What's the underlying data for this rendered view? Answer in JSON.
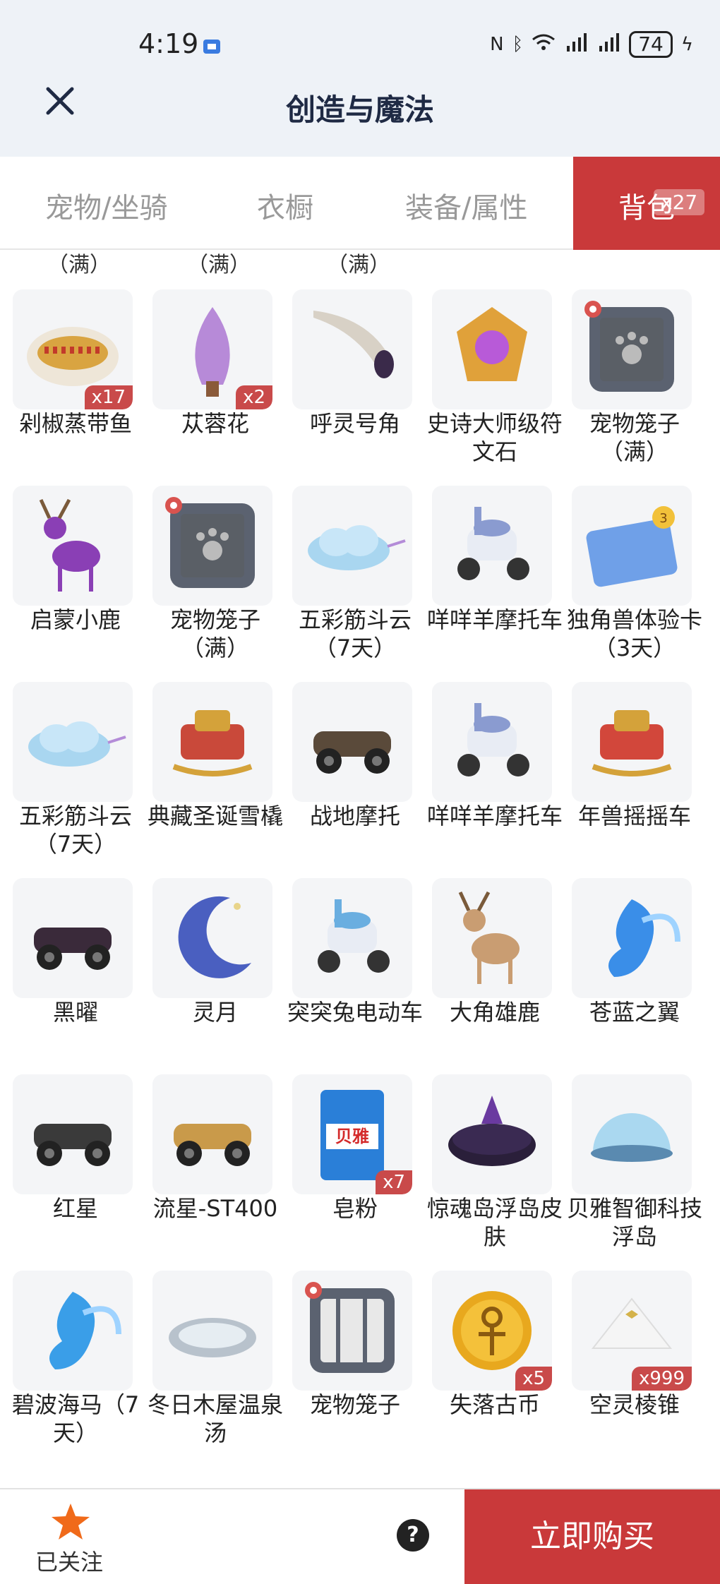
{
  "status": {
    "time": "4:19",
    "battery": "74"
  },
  "header": {
    "title": "创造与魔法"
  },
  "tabs": [
    {
      "label": "宠物/坐骑"
    },
    {
      "label": "衣橱"
    },
    {
      "label": "装备/属性"
    },
    {
      "label": "背包",
      "badge": "x27"
    }
  ],
  "partial_row": [
    "（满）",
    "（满）",
    "（满）"
  ],
  "items": [
    {
      "name": "剁椒蒸带鱼",
      "qty": "x17",
      "icon": "fish-dish-icon",
      "color": "#d9a441"
    },
    {
      "name": "苁蓉花",
      "qty": "x2",
      "icon": "flower-icon",
      "color": "#b78ad8"
    },
    {
      "name": "呼灵号角",
      "qty": "",
      "icon": "horn-icon",
      "color": "#d8d1c6"
    },
    {
      "name": "史诗大师级符文石",
      "qty": "",
      "icon": "rune-stone-icon",
      "color": "#e0a13a"
    },
    {
      "name": "宠物笼子（满）",
      "qty": "",
      "icon": "pet-cage-icon",
      "color": "#5b6270"
    },
    {
      "name": "启蒙小鹿",
      "qty": "",
      "icon": "deer-icon",
      "color": "#8a3fb5"
    },
    {
      "name": "宠物笼子（满）",
      "qty": "",
      "icon": "pet-cage-icon",
      "color": "#5b6270"
    },
    {
      "name": "五彩筋斗云（7天）",
      "qty": "",
      "icon": "cloud-icon",
      "color": "#a9d6f0"
    },
    {
      "name": "咩咩羊摩托车",
      "qty": "",
      "icon": "scooter-icon",
      "color": "#8a9bd0"
    },
    {
      "name": "独角兽体验卡（3天）",
      "qty": "",
      "icon": "unicorn-card-icon",
      "color": "#6fa0e8"
    },
    {
      "name": "五彩筋斗云（7天）",
      "qty": "",
      "icon": "cloud-icon",
      "color": "#a9d6f0"
    },
    {
      "name": "典藏圣诞雪橇",
      "qty": "",
      "icon": "sleigh-icon",
      "color": "#c9493a"
    },
    {
      "name": "战地摩托",
      "qty": "",
      "icon": "motorcycle-icon",
      "color": "#5a4a3a"
    },
    {
      "name": "咩咩羊摩托车",
      "qty": "",
      "icon": "scooter-icon",
      "color": "#8a9bd0"
    },
    {
      "name": "年兽摇摇车",
      "qty": "",
      "icon": "beast-cart-icon",
      "color": "#d2473b"
    },
    {
      "name": "黑曜",
      "qty": "",
      "icon": "car-icon",
      "color": "#3a2a3a"
    },
    {
      "name": "灵月",
      "qty": "",
      "icon": "moon-icon",
      "color": "#4a5fc0"
    },
    {
      "name": "突突兔电动车",
      "qty": "",
      "icon": "e-scooter-icon",
      "color": "#6aaee0"
    },
    {
      "name": "大角雄鹿",
      "qty": "",
      "icon": "stag-icon",
      "color": "#c99d72"
    },
    {
      "name": "苍蓝之翼",
      "qty": "",
      "icon": "blue-wing-icon",
      "color": "#3a8ee8"
    },
    {
      "name": "红星",
      "qty": "",
      "icon": "motorbike-icon",
      "color": "#3a3a3a"
    },
    {
      "name": "流星-ST400",
      "qty": "",
      "icon": "hover-bike-icon",
      "color": "#c99a4a"
    },
    {
      "name": "皂粉",
      "qty": "x7",
      "icon": "detergent-icon",
      "color": "#2a7fd8",
      "brand": "贝雅"
    },
    {
      "name": "惊魂岛浮岛皮肤",
      "qty": "",
      "icon": "dark-island-icon",
      "color": "#2a1f3a"
    },
    {
      "name": "贝雅智御科技浮岛",
      "qty": "",
      "icon": "dome-island-icon",
      "color": "#9cd2ee"
    },
    {
      "name": "碧波海马（7天）",
      "qty": "",
      "icon": "seahorse-icon",
      "color": "#3a9ee8"
    },
    {
      "name": "冬日木屋温泉汤",
      "qty": "",
      "icon": "hot-spring-icon",
      "color": "#b8c2cc"
    },
    {
      "name": "宠物笼子",
      "qty": "",
      "icon": "pet-cage-empty-icon",
      "color": "#5b6270"
    },
    {
      "name": "失落古币",
      "qty": "x5",
      "icon": "coin-icon",
      "color": "#e8a81e"
    },
    {
      "name": "空灵棱锥",
      "qty": "x999",
      "icon": "pyramid-icon",
      "color": "#e6e6e6"
    }
  ],
  "bottom": {
    "follow_label": "已关注",
    "help": "?",
    "buy_label": "立即购买"
  }
}
